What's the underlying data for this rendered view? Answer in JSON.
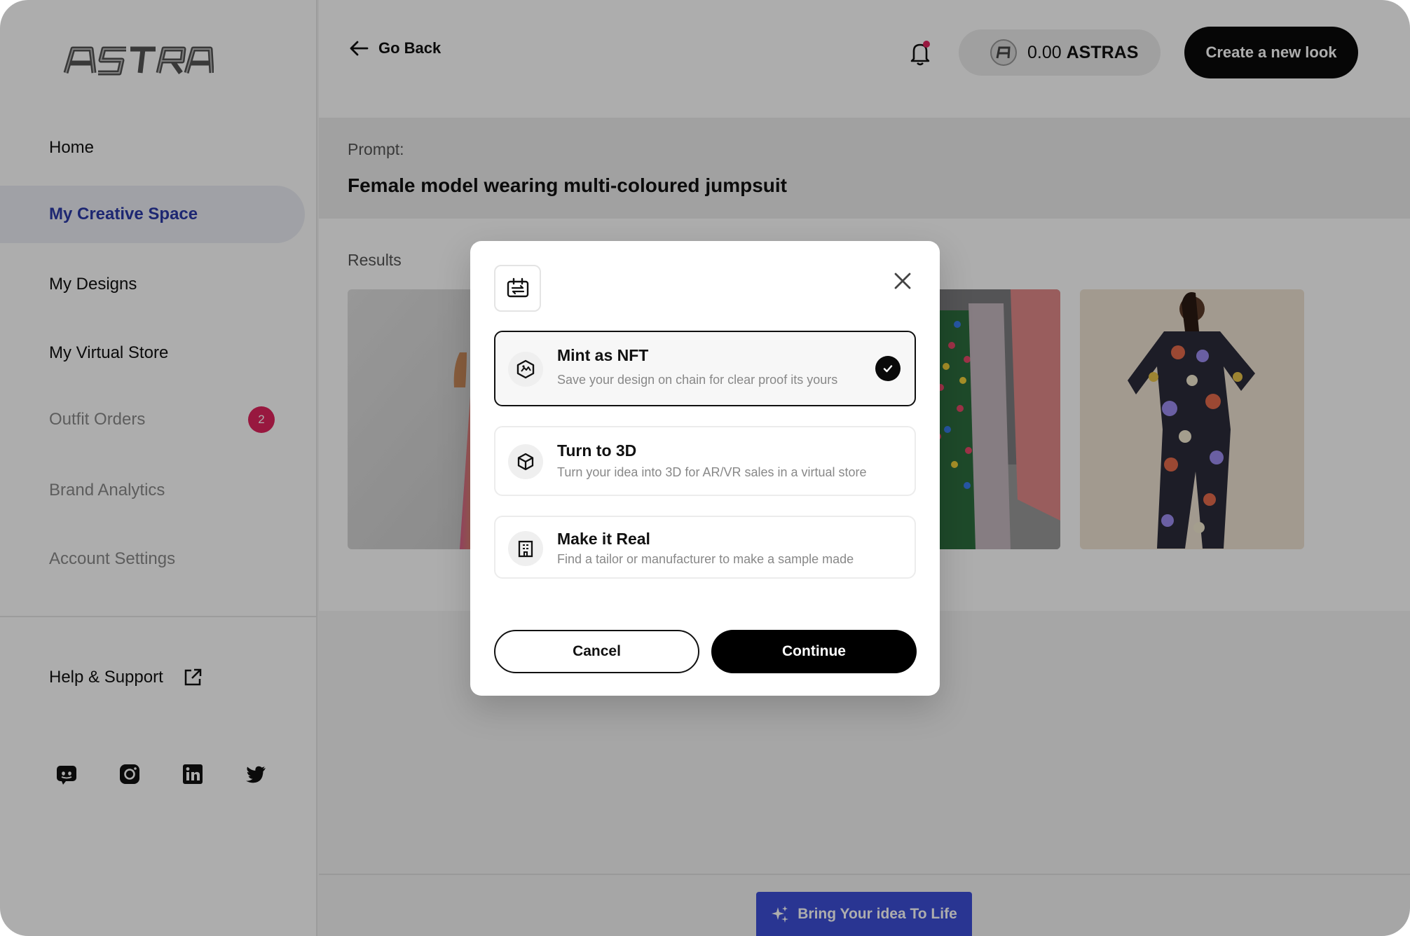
{
  "app": {
    "logo_text": "ASTRA"
  },
  "sidebar": {
    "items": [
      {
        "label": "Home"
      },
      {
        "label": "My Creative Space"
      },
      {
        "label": "My Designs"
      },
      {
        "label": "My Virtual Store"
      },
      {
        "label": "Outfit Orders",
        "badge": "2"
      },
      {
        "label": "Brand Analytics"
      },
      {
        "label": "Account Settings"
      }
    ],
    "help_label": "Help & Support",
    "socials": [
      "discord-icon",
      "instagram-icon",
      "linkedin-icon",
      "twitter-icon"
    ]
  },
  "header": {
    "back_label": "Go Back",
    "balance": "0.00",
    "currency": "ASTRAS",
    "create_label": "Create a new look"
  },
  "prompt": {
    "label": "Prompt:",
    "text": "Female model wearing multi-coloured jumpsuit"
  },
  "results": {
    "label": "Results"
  },
  "bottom": {
    "cta_label": "Bring Your idea To Life"
  },
  "modal": {
    "options": [
      {
        "title": "Mint as NFT",
        "description": "Save your design on chain for clear proof its yours",
        "selected": true,
        "icon": "nft-icon"
      },
      {
        "title": "Turn to 3D",
        "description": "Turn your idea into 3D for AR/VR sales in a virtual store",
        "selected": false,
        "icon": "cube-icon"
      },
      {
        "title": "Make it Real",
        "description": "Find a tailor or manufacturer to make a sample made",
        "selected": false,
        "icon": "building-icon"
      }
    ],
    "cancel_label": "Cancel",
    "continue_label": "Continue"
  },
  "colors": {
    "accent": "#2c3aa8",
    "cta_blue": "#3d4ed8",
    "badge": "#e0245e",
    "primary_button": "#0a0a0a"
  }
}
